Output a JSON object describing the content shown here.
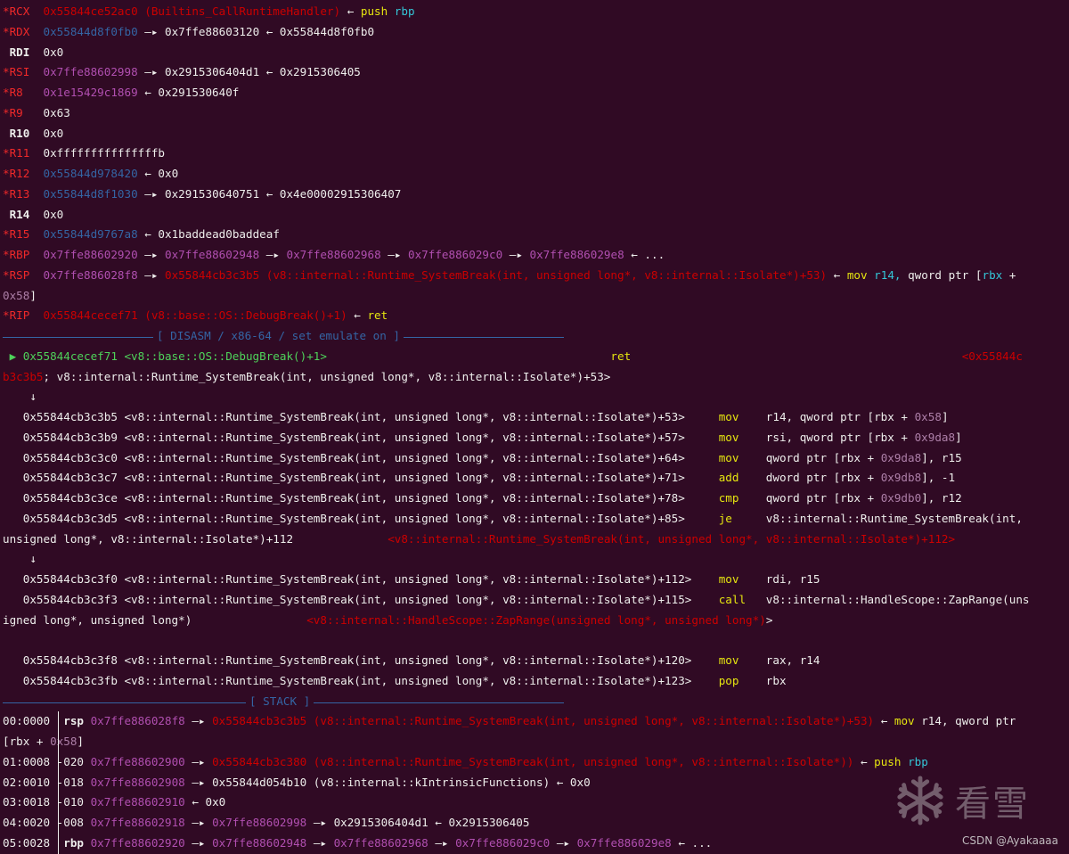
{
  "colors": {
    "background": "#300a24",
    "white": "#eeeeec",
    "changed_register": "#ef2929",
    "code_pointer": "#cc0000",
    "heap_pointer": "#3465a4",
    "stack_pointer": "#b04fb0",
    "mnemonic": "#e5e510",
    "register_name": "#34c7d8",
    "current_instruction": "#4ed25a"
  },
  "registers": [
    [
      [
        "*RCX",
        "red"
      ],
      [
        "  0x55844ce52ac0 (Builtins_CallRuntimeHandler) ",
        "dred"
      ],
      [
        "← ",
        "wh"
      ],
      [
        "push",
        "yel"
      ],
      [
        " rbp",
        "cyan"
      ]
    ],
    [
      [
        "*RDX",
        "red"
      ],
      [
        "  0x55844d8f0fb0",
        "blue"
      ],
      [
        " —▸ 0x7ffe88603120 ← 0x55844d8f0fb0",
        "wh"
      ]
    ],
    [
      [
        " RDI",
        "bwh"
      ],
      [
        "  0x0",
        "wh"
      ]
    ],
    [
      [
        "*RSI",
        "red"
      ],
      [
        "  0x7ffe88602998",
        "mag"
      ],
      [
        " —▸ 0x2915306404d1 ← 0x2915306405",
        "wh"
      ]
    ],
    [
      [
        "*R8",
        "red"
      ],
      [
        "   0x1e15429c1869",
        "mag"
      ],
      [
        " ← 0x291530640f",
        "wh"
      ]
    ],
    [
      [
        "*R9",
        "red"
      ],
      [
        "   0x63",
        "wh"
      ]
    ],
    [
      [
        " R10",
        "bwh"
      ],
      [
        "  0x0",
        "wh"
      ]
    ],
    [
      [
        "*R11",
        "red"
      ],
      [
        "  0xfffffffffffffffb",
        "wh"
      ]
    ],
    [
      [
        "*R12",
        "red"
      ],
      [
        "  0x55844d978420",
        "blue"
      ],
      [
        " ← 0x0",
        "wh"
      ]
    ],
    [
      [
        "*R13",
        "red"
      ],
      [
        "  0x55844d8f1030",
        "blue"
      ],
      [
        " —▸ 0x291530640751 ← 0x4e00002915306407",
        "wh"
      ]
    ],
    [
      [
        " R14",
        "bwh"
      ],
      [
        "  0x0",
        "wh"
      ]
    ],
    [
      [
        "*R15",
        "red"
      ],
      [
        "  0x55844d9767a8",
        "blue"
      ],
      [
        " ← 0x1baddead0baddeaf",
        "wh"
      ]
    ],
    [
      [
        "*RBP",
        "red"
      ],
      [
        "  0x7ffe88602920",
        "mag"
      ],
      [
        " —▸ ",
        "wh"
      ],
      [
        "0x7ffe88602948",
        "mag"
      ],
      [
        " —▸ ",
        "wh"
      ],
      [
        "0x7ffe88602968",
        "mag"
      ],
      [
        " —▸ ",
        "wh"
      ],
      [
        "0x7ffe886029c0",
        "mag"
      ],
      [
        " —▸ ",
        "wh"
      ],
      [
        "0x7ffe886029e8",
        "mag"
      ],
      [
        " ← ...",
        "wh"
      ]
    ],
    [
      [
        "*RSP",
        "red"
      ],
      [
        "  0x7ffe886028f8",
        "mag"
      ],
      [
        " —▸ ",
        "wh"
      ],
      [
        "0x55844cb3c3b5 (v8::internal::Runtime_SystemBreak(int, unsigned long*, v8::internal::Isolate*)+53) ",
        "dred"
      ],
      [
        "← ",
        "wh"
      ],
      [
        "mov",
        "yel"
      ],
      [
        " r14, ",
        "cyan"
      ],
      [
        "qword ptr ",
        "wh"
      ],
      [
        "[",
        "wh"
      ],
      [
        "rbx",
        "cyan"
      ],
      [
        " + ",
        "wh"
      ]
    ],
    [
      [
        "0x58",
        "pur"
      ],
      [
        "]",
        "wh"
      ]
    ],
    [
      [
        "*RIP",
        "red"
      ],
      [
        "  0x55844cecef71 (v8::base::OS::DebugBreak()+1) ",
        "dred"
      ],
      [
        "← ",
        "wh"
      ],
      [
        "ret",
        "yel"
      ]
    ]
  ],
  "disasm_header": {
    "title": "[ DISASM / x86-64 / set emulate on ]"
  },
  "disasm": [
    [
      [
        " ▶ 0x55844cecef71 <v8::base::OS::DebugBreak()+1>",
        "green"
      ],
      [
        "                                          ",
        "wh"
      ],
      [
        "ret",
        "yel"
      ],
      [
        "                                                 ",
        "wh"
      ],
      [
        "<0x55844c",
        "dred"
      ]
    ],
    [
      [
        "b3c3b5",
        "dred"
      ],
      [
        "; v8::internal::Runtime_SystemBreak(int, unsigned long*, v8::internal::Isolate*)+53>",
        "wh"
      ]
    ],
    [
      [
        "    ↓",
        "wh"
      ]
    ],
    [
      [
        "   0x55844cb3c3b5 <v8::internal::Runtime_SystemBreak(int, unsigned long*, v8::internal::Isolate*)+53>     ",
        "wh"
      ],
      [
        "mov",
        "yel"
      ],
      [
        "    r14, qword ptr [rbx + ",
        "wh"
      ],
      [
        "0x58",
        "pur"
      ],
      [
        "]",
        "wh"
      ]
    ],
    [
      [
        "   0x55844cb3c3b9 <v8::internal::Runtime_SystemBreak(int, unsigned long*, v8::internal::Isolate*)+57>     ",
        "wh"
      ],
      [
        "mov",
        "yel"
      ],
      [
        "    rsi, qword ptr [rbx + ",
        "wh"
      ],
      [
        "0x9da8",
        "pur"
      ],
      [
        "]",
        "wh"
      ]
    ],
    [
      [
        "   0x55844cb3c3c0 <v8::internal::Runtime_SystemBreak(int, unsigned long*, v8::internal::Isolate*)+64>     ",
        "wh"
      ],
      [
        "mov",
        "yel"
      ],
      [
        "    qword ptr [rbx + ",
        "wh"
      ],
      [
        "0x9da8",
        "pur"
      ],
      [
        "], r15",
        "wh"
      ]
    ],
    [
      [
        "   0x55844cb3c3c7 <v8::internal::Runtime_SystemBreak(int, unsigned long*, v8::internal::Isolate*)+71>     ",
        "wh"
      ],
      [
        "add",
        "yel"
      ],
      [
        "    dword ptr [rbx + ",
        "wh"
      ],
      [
        "0x9db8",
        "pur"
      ],
      [
        "], -1",
        "wh"
      ]
    ],
    [
      [
        "   0x55844cb3c3ce <v8::internal::Runtime_SystemBreak(int, unsigned long*, v8::internal::Isolate*)+78>     ",
        "wh"
      ],
      [
        "cmp",
        "yel"
      ],
      [
        "    qword ptr [rbx + ",
        "wh"
      ],
      [
        "0x9db0",
        "pur"
      ],
      [
        "], r12",
        "wh"
      ]
    ],
    [
      [
        "   0x55844cb3c3d5 <v8::internal::Runtime_SystemBreak(int, unsigned long*, v8::internal::Isolate*)+85>     ",
        "wh"
      ],
      [
        "je",
        "yel"
      ],
      [
        "     v8::internal::Runtime_SystemBreak(int, ",
        "wh"
      ]
    ],
    [
      [
        "unsigned long*, v8::internal::Isolate*)+112",
        "wh"
      ],
      [
        "              ",
        "wh"
      ],
      [
        "<v8::internal::Runtime_SystemBreak(int, unsigned long*, v8::internal::Isolate*)+112>",
        "dred"
      ]
    ],
    [
      [
        "    ↓",
        "wh"
      ]
    ],
    [
      [
        "   0x55844cb3c3f0 <v8::internal::Runtime_SystemBreak(int, unsigned long*, v8::internal::Isolate*)+112>    ",
        "wh"
      ],
      [
        "mov",
        "yel"
      ],
      [
        "    rdi, r15",
        "wh"
      ]
    ],
    [
      [
        "   0x55844cb3c3f3 <v8::internal::Runtime_SystemBreak(int, unsigned long*, v8::internal::Isolate*)+115>    ",
        "wh"
      ],
      [
        "call",
        "yel"
      ],
      [
        "   v8::internal::HandleScope::ZapRange(uns",
        "wh"
      ]
    ],
    [
      [
        "igned long*, unsigned long*)",
        "wh"
      ],
      [
        "                 ",
        "wh"
      ],
      [
        "<v8::internal::HandleScope::ZapRange(unsigned long*, unsigned long*)",
        "dred"
      ],
      [
        ">",
        "wh"
      ]
    ],
    [
      [
        "",
        "wh"
      ]
    ],
    [
      [
        "   0x55844cb3c3f8 <v8::internal::Runtime_SystemBreak(int, unsigned long*, v8::internal::Isolate*)+120>    ",
        "wh"
      ],
      [
        "mov",
        "yel"
      ],
      [
        "    rax, r14",
        "wh"
      ]
    ],
    [
      [
        "   0x55844cb3c3fb <v8::internal::Runtime_SystemBreak(int, unsigned long*, v8::internal::Isolate*)+123>    ",
        "wh"
      ],
      [
        "pop",
        "yel"
      ],
      [
        "    rbx",
        "wh"
      ]
    ]
  ],
  "stack_header": {
    "title": "[ STACK ]"
  },
  "stack": [
    [
      [
        "00:0000",
        "wh"
      ],
      [
        "  ",
        "wh"
      ],
      [
        "rsp",
        "bwh"
      ],
      [
        " 0x7ffe886028f8",
        "mag"
      ],
      [
        " —▸ ",
        "wh"
      ],
      [
        "0x55844cb3c3b5 (v8::internal::Runtime_SystemBreak(int, unsigned long*, v8::internal::Isolate*)+53) ",
        "dred"
      ],
      [
        "← ",
        "wh"
      ],
      [
        "mov",
        "yel"
      ],
      [
        " r14, qword ptr",
        "wh"
      ]
    ],
    [
      [
        "[rbx + ",
        "wh"
      ],
      [
        "0x58",
        "pur"
      ],
      [
        "]",
        "wh"
      ]
    ],
    [
      [
        "01:0008",
        "wh"
      ],
      [
        " -020",
        "wh"
      ],
      [
        " 0x7ffe88602900",
        "mag"
      ],
      [
        " —▸ ",
        "wh"
      ],
      [
        "0x55844cb3c380 (v8::internal::Runtime_SystemBreak(int, unsigned long*, v8::internal::Isolate*)) ",
        "dred"
      ],
      [
        "← ",
        "wh"
      ],
      [
        "push",
        "yel"
      ],
      [
        " rbp",
        "cyan"
      ]
    ],
    [
      [
        "02:0010",
        "wh"
      ],
      [
        " -018",
        "wh"
      ],
      [
        " 0x7ffe88602908",
        "mag"
      ],
      [
        " —▸ 0x55844d054b10 (v8::internal::kIntrinsicFunctions) ← 0x0",
        "wh"
      ]
    ],
    [
      [
        "03:0018",
        "wh"
      ],
      [
        " -010",
        "wh"
      ],
      [
        " 0x7ffe88602910",
        "mag"
      ],
      [
        " ← 0x0",
        "wh"
      ]
    ],
    [
      [
        "04:0020",
        "wh"
      ],
      [
        " -008",
        "wh"
      ],
      [
        " 0x7ffe88602918",
        "mag"
      ],
      [
        " —▸ ",
        "wh"
      ],
      [
        "0x7ffe88602998",
        "mag"
      ],
      [
        " —▸ 0x2915306404d1 ← 0x2915306405",
        "wh"
      ]
    ],
    [
      [
        "05:0028",
        "wh"
      ],
      [
        "  ",
        "wh"
      ],
      [
        "rbp",
        "bwh"
      ],
      [
        " 0x7ffe88602920",
        "mag"
      ],
      [
        " —▸ ",
        "wh"
      ],
      [
        "0x7ffe88602948",
        "mag"
      ],
      [
        " —▸ ",
        "wh"
      ],
      [
        "0x7ffe88602968",
        "mag"
      ],
      [
        " —▸ ",
        "wh"
      ],
      [
        "0x7ffe886029c0",
        "mag"
      ],
      [
        " —▸ ",
        "wh"
      ],
      [
        "0x7ffe886029e8",
        "mag"
      ],
      [
        " ← ...",
        "wh"
      ]
    ]
  ],
  "watermark": {
    "icon": "snowflake-icon",
    "text": "看雪"
  },
  "credit": "CSDN @Ayakaaaa"
}
